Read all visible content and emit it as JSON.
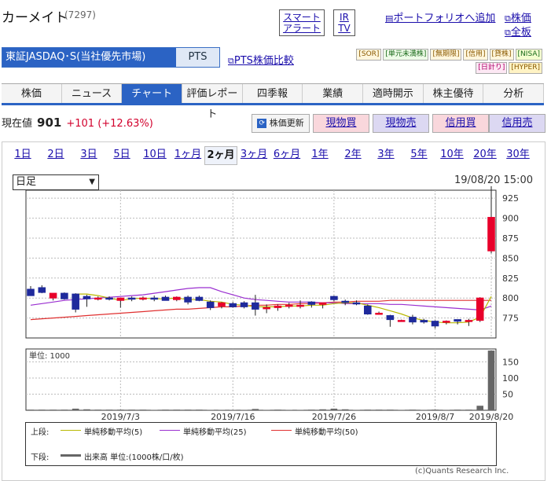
{
  "header": {
    "company": "カーメイト",
    "code": "(7297)",
    "smart_alert_1": "スマート",
    "smart_alert_2": "アラート",
    "ir_1": "IR",
    "ir_2": "TV",
    "portfolio": "ポートフォリオへ追加",
    "stock_price": "株価",
    "all_board": "全板"
  },
  "market": {
    "selected": "東証JASDAQ･S(当社優先市場)",
    "pts": "PTS",
    "pts_compare": "PTS株価比較",
    "tags": [
      "[SOR]",
      "[単元未満株]",
      "[無期限]",
      "[信用]",
      "[貸株]",
      "[NISA]",
      "[日計り]",
      "[HYPER]"
    ]
  },
  "tabs": [
    "株価",
    "ニュース",
    "チャート",
    "評価レポート",
    "四季報",
    "業績",
    "適時開示",
    "株主優待",
    "分析"
  ],
  "price": {
    "label": "現在値",
    "value": "901",
    "change": "+101",
    "pct": "(+12.63%)"
  },
  "actions": {
    "refresh": "株価更新",
    "buy": "現物買",
    "sell": "現物売",
    "margin_buy": "信用買",
    "margin_sell": "信用売"
  },
  "periods": [
    "1日",
    "2日",
    "3日",
    "5日",
    "10日",
    "1ヶ月",
    "2ヶ月",
    "3ヶ月",
    "6ヶ月",
    "1年",
    "2年",
    "3年",
    "5年",
    "10年",
    "20年",
    "30年"
  ],
  "chart_controls": {
    "interval": "日足",
    "timestamp": "19/08/20 15:00"
  },
  "legend": {
    "upper": "上段:",
    "lower": "下段:",
    "ma5": "単純移動平均(5)",
    "ma25": "単純移動平均(25)",
    "ma50": "単純移動平均(50)",
    "volume": "出来高 単位:(1000株/口/枚)"
  },
  "credit": "(c)Quants Research Inc.",
  "colors": {
    "up": "#e8002a",
    "down": "#1f2a9c",
    "ma5": "#b8b800",
    "ma25": "#9a2fd0",
    "ma50": "#e03030",
    "volume": "#666666"
  },
  "chart_data": {
    "type": "candlestick",
    "y_ticks": [
      775,
      800,
      825,
      850,
      875,
      900,
      925
    ],
    "ylim": [
      750,
      935
    ],
    "x_labels": [
      "2019/7/3",
      "2019/7/16",
      "2019/7/26",
      "2019/8/7",
      "2019/8/20"
    ],
    "volume_unit": "単位: 1000",
    "volume_ticks": [
      50,
      100,
      150
    ],
    "volume_ylim": [
      0,
      190
    ],
    "candles": [
      {
        "o": 811,
        "h": 815,
        "l": 803,
        "c": 803
      },
      {
        "o": 813,
        "h": 816,
        "l": 806,
        "c": 807
      },
      {
        "o": 800,
        "h": 806,
        "l": 797,
        "c": 806
      },
      {
        "o": 806,
        "h": 807,
        "l": 798,
        "c": 799
      },
      {
        "o": 805,
        "h": 806,
        "l": 782,
        "c": 786
      },
      {
        "o": 802,
        "h": 804,
        "l": 789,
        "c": 799
      },
      {
        "o": 800,
        "h": 802,
        "l": 797,
        "c": 800
      },
      {
        "o": 800,
        "h": 802,
        "l": 797,
        "c": 799
      },
      {
        "o": 797,
        "h": 800,
        "l": 788,
        "c": 800
      },
      {
        "o": 800,
        "h": 802,
        "l": 796,
        "c": 799
      },
      {
        "o": 800,
        "h": 802,
        "l": 797,
        "c": 800
      },
      {
        "o": 800,
        "h": 803,
        "l": 796,
        "c": 799
      },
      {
        "o": 801,
        "h": 803,
        "l": 797,
        "c": 797
      },
      {
        "o": 798,
        "h": 802,
        "l": 796,
        "c": 801
      },
      {
        "o": 801,
        "h": 803,
        "l": 792,
        "c": 795
      },
      {
        "o": 801,
        "h": 803,
        "l": 796,
        "c": 797
      },
      {
        "o": 795,
        "h": 797,
        "l": 785,
        "c": 788
      },
      {
        "o": 790,
        "h": 795,
        "l": 787,
        "c": 794
      },
      {
        "o": 793,
        "h": 795,
        "l": 788,
        "c": 789
      },
      {
        "o": 794,
        "h": 796,
        "l": 787,
        "c": 789
      },
      {
        "o": 794,
        "h": 804,
        "l": 778,
        "c": 786
      },
      {
        "o": 788,
        "h": 792,
        "l": 781,
        "c": 788
      },
      {
        "o": 788,
        "h": 792,
        "l": 784,
        "c": 790
      },
      {
        "o": 790,
        "h": 794,
        "l": 787,
        "c": 791
      },
      {
        "o": 791,
        "h": 797,
        "l": 787,
        "c": 791
      },
      {
        "o": 795,
        "h": 796,
        "l": 788,
        "c": 792
      },
      {
        "o": 792,
        "h": 794,
        "l": 787,
        "c": 794
      },
      {
        "o": 802,
        "h": 803,
        "l": 796,
        "c": 798
      },
      {
        "o": 796,
        "h": 798,
        "l": 791,
        "c": 795
      },
      {
        "o": 794,
        "h": 797,
        "l": 791,
        "c": 793
      },
      {
        "o": 790,
        "h": 792,
        "l": 779,
        "c": 780
      },
      {
        "o": 780,
        "h": 783,
        "l": 779,
        "c": 781
      },
      {
        "o": 778,
        "h": 779,
        "l": 764,
        "c": 773
      },
      {
        "o": 772,
        "h": 773,
        "l": 771,
        "c": 772
      },
      {
        "o": 776,
        "h": 779,
        "l": 767,
        "c": 770
      },
      {
        "o": 772,
        "h": 774,
        "l": 768,
        "c": 770
      },
      {
        "o": 771,
        "h": 772,
        "l": 762,
        "c": 765
      },
      {
        "o": 770,
        "h": 772,
        "l": 767,
        "c": 771
      },
      {
        "o": 773,
        "h": 773,
        "l": 767,
        "c": 771
      },
      {
        "o": 772,
        "h": 774,
        "l": 765,
        "c": 772
      },
      {
        "o": 772,
        "h": 801,
        "l": 770,
        "c": 800
      },
      {
        "o": 859,
        "h": 940,
        "l": 856,
        "c": 901
      }
    ],
    "volumes": [
      2,
      2,
      2,
      2,
      5,
      3,
      2,
      2,
      2,
      2,
      2,
      1,
      2,
      2,
      2,
      2,
      1,
      1,
      1,
      1,
      4,
      1,
      2,
      1,
      1,
      2,
      3,
      5,
      3,
      1,
      2,
      2,
      2,
      1,
      2,
      1,
      2,
      1,
      2,
      2,
      14,
      185
    ],
    "ma5": [
      null,
      null,
      null,
      null,
      805,
      805,
      803,
      800,
      797,
      799,
      800,
      799,
      799,
      800,
      798,
      798,
      796,
      795,
      792,
      791,
      789,
      789,
      789,
      790,
      790,
      791,
      791,
      793,
      794,
      794,
      791,
      788,
      784,
      780,
      775,
      772,
      770,
      769,
      769,
      770,
      776,
      802
    ],
    "ma25": [
      791,
      793,
      795,
      797,
      798,
      799,
      800,
      801,
      802,
      803,
      804,
      806,
      808,
      810,
      812,
      813,
      813,
      808,
      804,
      800,
      798,
      797,
      796,
      795,
      795,
      795,
      794,
      794,
      793,
      793,
      793,
      793,
      792,
      792,
      791,
      790,
      789,
      788,
      787,
      786,
      785,
      790
    ],
    "ma50": [
      773,
      774,
      775,
      776,
      777,
      778,
      779,
      780,
      781,
      782,
      783,
      784,
      785,
      786,
      786,
      787,
      788,
      789,
      789,
      790,
      791,
      791,
      792,
      792,
      793,
      793,
      794,
      795,
      795,
      796,
      796,
      796,
      797,
      797,
      797,
      797,
      797,
      797,
      797,
      797,
      797,
      797
    ]
  }
}
